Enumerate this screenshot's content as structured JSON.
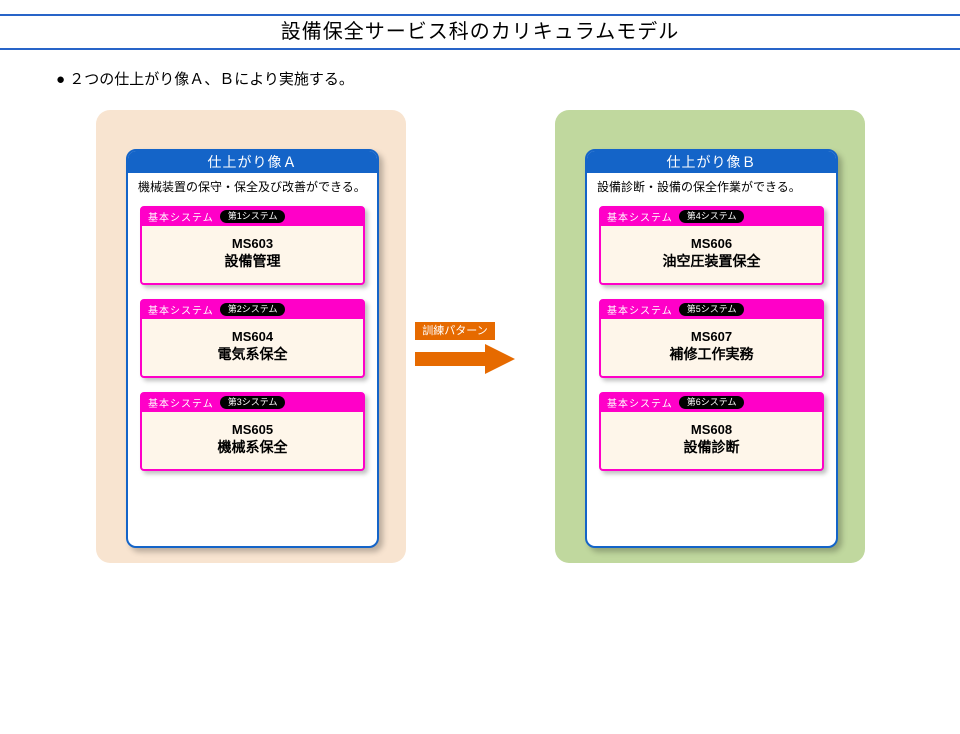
{
  "title": "設備保全サービス科のカリキュラムモデル",
  "subtitle": "２つの仕上がり像Ａ、Ｂにより実施する。",
  "arrow_label": "訓練パターン",
  "panel_a": {
    "header": "仕上がり像Ａ",
    "description": "機械装置の保守・保全及び改善ができる。",
    "modules": [
      {
        "left": "基本システム",
        "pill": "第1システム",
        "code": "MS603",
        "name": "設備管理"
      },
      {
        "left": "基本システム",
        "pill": "第2システム",
        "code": "MS604",
        "name": "電気系保全"
      },
      {
        "left": "基本システム",
        "pill": "第3システム",
        "code": "MS605",
        "name": "機械系保全"
      }
    ]
  },
  "panel_b": {
    "header": "仕上がり像Ｂ",
    "description": "設備診断・設備の保全作業ができる。",
    "modules": [
      {
        "left": "基本システム",
        "pill": "第4システム",
        "code": "MS606",
        "name": "油空圧装置保全"
      },
      {
        "left": "基本システム",
        "pill": "第5システム",
        "code": "MS607",
        "name": "補修工作実務"
      },
      {
        "left": "基本システム",
        "pill": "第6システム",
        "code": "MS608",
        "name": "設備診断"
      }
    ]
  },
  "colors": {
    "rule": "#2864c8",
    "panel_a_bg": "#f8e4d0",
    "panel_b_bg": "#c0d89e",
    "card_border": "#1464c8",
    "module_accent": "#ff00c8",
    "arrow": "#e66a00"
  }
}
